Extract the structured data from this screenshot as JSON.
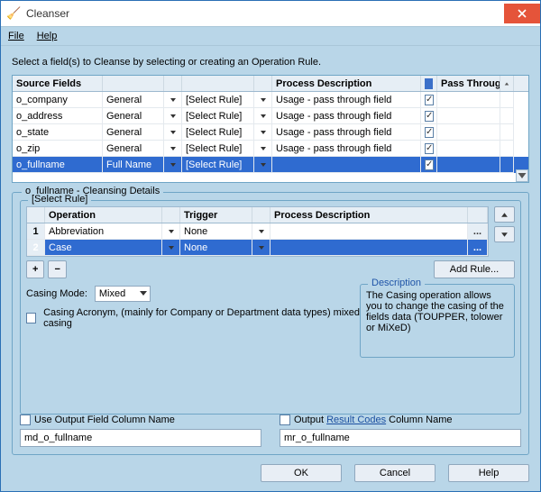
{
  "window": {
    "title": "Cleanser"
  },
  "menu": {
    "file": "File",
    "help": "Help"
  },
  "instruction": "Select a field(s) to Cleanse by selecting or creating an Operation Rule.",
  "grid1": {
    "headers": {
      "source": "Source Fields",
      "process": "Process Description",
      "pass": "Pass Through"
    },
    "rule_placeholder": "[Select Rule]",
    "rows": [
      {
        "name": "o_company",
        "type": "General",
        "desc": "Usage - pass through field",
        "pass": true,
        "selected": false
      },
      {
        "name": "o_address",
        "type": "General",
        "desc": "Usage - pass through field",
        "pass": true,
        "selected": false
      },
      {
        "name": "o_state",
        "type": "General",
        "desc": "Usage - pass through field",
        "pass": true,
        "selected": false
      },
      {
        "name": "o_zip",
        "type": "General",
        "desc": "Usage - pass through field",
        "pass": true,
        "selected": false
      },
      {
        "name": "o_fullname",
        "type": "Full Name",
        "desc": "",
        "pass": true,
        "selected": true
      }
    ]
  },
  "details": {
    "title": "o_fullname - Cleansing Details",
    "inner_title": "[Select Rule]",
    "headers": {
      "op": "Operation",
      "trig": "Trigger",
      "proc": "Process Description"
    },
    "rows": [
      {
        "n": "1",
        "op": "Abbreviation",
        "trig": "None",
        "proc": "",
        "selected": false
      },
      {
        "n": "2",
        "op": "Case",
        "trig": "None",
        "proc": "",
        "selected": true
      }
    ],
    "add_rule": "Add Rule...",
    "casing_mode_label": "Casing Mode:",
    "casing_mode_value": "Mixed",
    "acronym_note": "Casing Acronym, (mainly for Company or Department data types) mixed casing",
    "description_title": "Description",
    "description_body": "The Casing operation allows you to change the casing of the fields data (TOUPPER, tolower or MiXeD)"
  },
  "outputs": {
    "use_field_label": "Use Output Field Column Name",
    "use_field_value": "md_o_fullname",
    "result_label_pre": "Output ",
    "result_link": "Result Codes",
    "result_label_post": " Column Name",
    "result_value": "mr_o_fullname"
  },
  "buttons": {
    "ok": "OK",
    "cancel": "Cancel",
    "help": "Help"
  }
}
